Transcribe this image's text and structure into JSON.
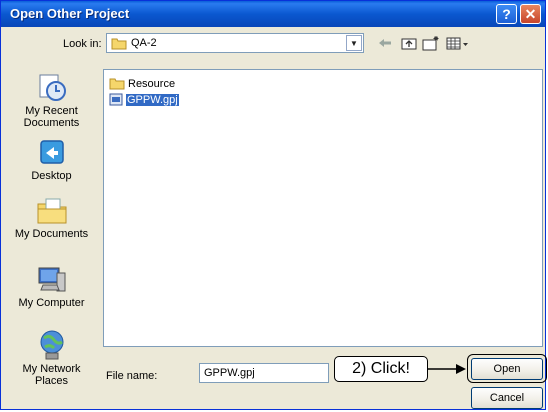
{
  "window": {
    "title": "Open Other Project",
    "help_label": "?",
    "close_label": "✕"
  },
  "lookin": {
    "label": "Look in:",
    "value": "QA-2",
    "arrow": "▼"
  },
  "toolbar": {
    "back_icon": "back-arrow-icon",
    "up_icon": "up-folder-icon",
    "new_folder_icon": "new-folder-icon",
    "views_icon": "views-menu-icon"
  },
  "places": [
    {
      "label": "My Recent Documents",
      "icon": "recent-documents-icon"
    },
    {
      "label": "Desktop",
      "icon": "desktop-icon"
    },
    {
      "label": "My Documents",
      "icon": "my-documents-icon"
    },
    {
      "label": "My Computer",
      "icon": "my-computer-icon"
    },
    {
      "label": "My Network Places",
      "icon": "network-places-icon"
    }
  ],
  "files": [
    {
      "name": "Resource",
      "type": "folder",
      "selected": false
    },
    {
      "name": "GPPW.gpj",
      "type": "project",
      "selected": true
    }
  ],
  "filename": {
    "label": "File name:",
    "value": "GPPW.gpj"
  },
  "callout": {
    "text": "2) Click!"
  },
  "buttons": {
    "open": "Open",
    "cancel": "Cancel"
  },
  "colors": {
    "titlebar": "#0a58d0",
    "dialog_bg": "#ece9d8",
    "selection": "#316ac5"
  }
}
